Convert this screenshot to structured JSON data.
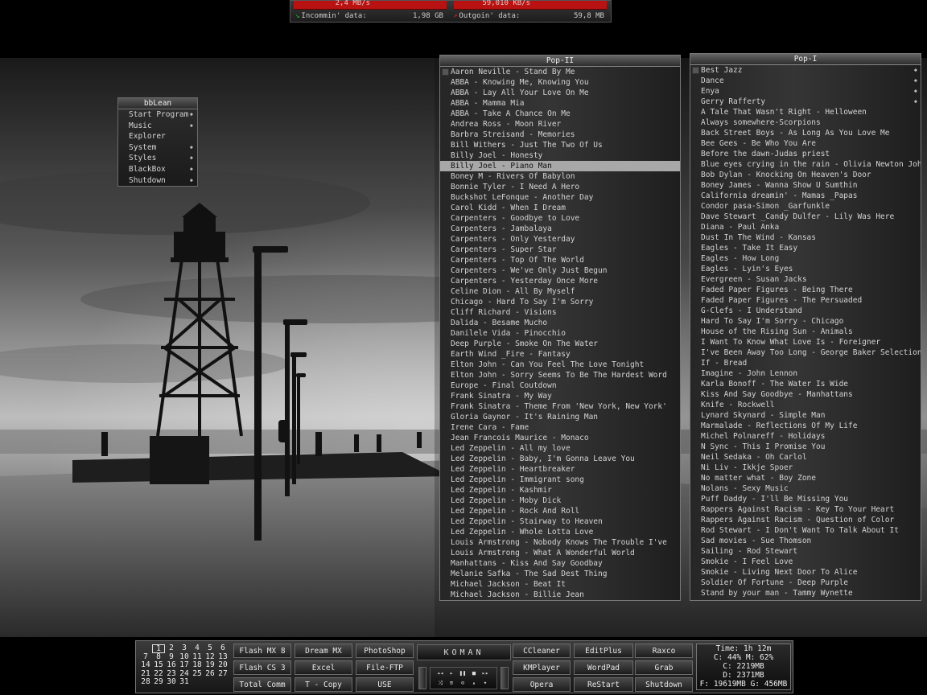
{
  "netmeter": {
    "in_rate": "2,4 MB/s",
    "out_rate": "59,010 KB/s",
    "in_label": "Incommin' data:",
    "in_value": "1,98 GB",
    "out_label": "Outgoin' data:",
    "out_value": "59,8 MB",
    "colors": {
      "bar": "#b81212",
      "in_arrow": "#2fbf2f",
      "out_arrow": "#d43030"
    }
  },
  "bbmenu": {
    "title": "bbLean",
    "items": [
      {
        "label": "Start Program",
        "submenu": true
      },
      {
        "label": "Music",
        "submenu": true
      },
      {
        "label": "Explorer",
        "submenu": false
      },
      {
        "label": "System",
        "submenu": true
      },
      {
        "label": "Styles",
        "submenu": true
      },
      {
        "label": "BlackBox",
        "submenu": true
      },
      {
        "label": "Shutdown",
        "submenu": true
      }
    ]
  },
  "pop2": {
    "title": "Pop-II",
    "selected_index": 9,
    "items": [
      "Aaron Neville - Stand By Me",
      "ABBA - Knowing Me, Knowing You",
      "ABBA - Lay All Your Love On Me",
      "ABBA - Mamma Mia",
      "ABBA - Take A Chance On Me",
      "Andrea Ross - Moon River",
      "Barbra Streisand - Memories",
      "Bill Withers - Just The Two Of Us",
      "Billy Joel - Honesty",
      "Billy Joel - Piano Man",
      "Boney M - Rivers Of Babylon",
      "Bonnie Tyler - I Need A Hero",
      "Buckshot LeFonque - Another Day",
      "Carol Kidd - When I Dream",
      "Carpenters - Goodbye to Love",
      "Carpenters - Jambalaya",
      "Carpenters - Only Yesterday",
      "Carpenters - Super Star",
      "Carpenters - Top Of The World",
      "Carpenters - We've Only Just Begun",
      "Carpenters - Yesterday Once More",
      "Celine Dion - All By Myself",
      "Chicago - Hard To Say I'm Sorry",
      "Cliff Richard - Visions",
      "Dalida - Besame Mucho",
      "Danilele Vida - Pinocchio",
      "Deep Purple - Smoke On The Water",
      "Earth Wind _Fire - Fantasy",
      "Elton John - Can You Feel The Love Tonight",
      "Elton John - Sorry Seems To Be The Hardest Word",
      "Europe - Final Coutdown",
      "Frank Sinatra - My Way",
      "Frank Sinatra - Theme From 'New York, New York'",
      "Gloria Gaynor - It's Raining Man",
      "Irene Cara - Fame",
      "Jean Francois Maurice - Monaco",
      "Led Zeppelin - All my love",
      "Led Zeppelin - Baby, I'm Gonna Leave You",
      "Led Zeppelin - Heartbreaker",
      "Led Zeppelin - Immigrant song",
      "Led Zeppelin - Kashmir",
      "Led Zeppelin - Moby Dick",
      "Led Zeppelin - Rock And Roll",
      "Led Zeppelin - Stairway to Heaven",
      "Led Zeppelin - Whole Lotta Love",
      "Louis Armstrong - Nobody Knows The Trouble I've",
      "Louis Armstrong - What A Wonderful World",
      "Manhattans - Kiss And Say Goodbay",
      "Melanie Safka - The Sad Dest Thing",
      "Michael Jackson - Beat It",
      "Michael Jackson - Billie Jean"
    ]
  },
  "pop1": {
    "title": "Pop-I",
    "folders": [
      "Best Jazz",
      "Dance",
      "Enya",
      "Gerry Rafferty"
    ],
    "items": [
      "A Tale That Wasn't Right - Helloween",
      "Always somewhere-Scorpions",
      "Back Street Boys - As Long As You Love Me",
      "Bee Gees - Be Who You Are",
      "Before the dawn-Judas priest",
      "Blue eyes crying in the rain - Olivia Newton John",
      "Bob Dylan - Knocking On Heaven's Door",
      "Boney James - Wanna Show U Sumthin",
      "California dreamin' - Mamas _Papas",
      "Condor pasa-Simon _Garfunkle",
      "Dave Stewart _Candy Dulfer - Lily Was Here",
      "Diana - Paul Anka",
      "Dust In The Wind - Kansas",
      "Eagles - Take It Easy",
      "Eagles - How Long",
      "Eagles - Lyin's Eyes",
      "Evergreen - Susan Jacks",
      "Faded Paper Figures - Being There",
      "Faded Paper Figures - The Persuaded",
      "G-Clefs - I Understand",
      "Hard To Say I'm Sorry - Chicago",
      "House of the Rising Sun - Animals",
      "I Want To Know What Love Is - Foreigner",
      "I've Been Away Too Long - George Baker Selection",
      "If - Bread",
      "Imagine - John Lennon",
      "Karla Bonoff - The Water Is Wide",
      "Kiss And Say Goodbye - Manhattans",
      "Knife - Rockwell",
      "Lynard Skynard - Simple Man",
      "Marmalade - Reflections Of My Life",
      "Michel Polnareff - Holidays",
      "N Sync - This I Promise You",
      "Neil Sedaka - Oh Carlol",
      "Ni Liv - Ikkje Spoer",
      "No matter what - Boy Zone",
      "Nolans - Sexy Music",
      "Puff Daddy - I'll Be Missing You",
      "Rappers Against Racism - Key To Your Heart",
      "Rappers Against Racism - Question of Color",
      "Rod Stewart - I Don't Want To Talk About It",
      "Sad movies - Sue Thomson",
      "Sailing - Rod Stewart",
      "Smokie - I Feel Love",
      "Smokie - Living Next Door To Alice",
      "Soldier Of Fortune - Deep Purple",
      "Stand by your man - Tammy Wynette"
    ]
  },
  "calendar": {
    "today": "1",
    "rows": [
      [
        "",
        "1",
        "2",
        "3",
        "4",
        "5",
        "6"
      ],
      [
        "7",
        "8",
        "9",
        "10",
        "11",
        "12",
        "13"
      ],
      [
        "14",
        "15",
        "16",
        "17",
        "18",
        "19",
        "20"
      ],
      [
        "21",
        "22",
        "23",
        "24",
        "25",
        "26",
        "27"
      ],
      [
        "28",
        "29",
        "30",
        "31",
        "",
        "",
        ""
      ]
    ]
  },
  "launch_col1": [
    "Flash MX 8",
    "Flash CS 3",
    "Total Comm"
  ],
  "launch_col2": [
    "Dream MX",
    "Excel",
    "T - Copy"
  ],
  "launch_col3": [
    "PhotoShop",
    "File-FTP",
    "USE"
  ],
  "koman": {
    "title": "KOMAN",
    "controls": [
      "◂◂",
      "▸",
      "❚❚",
      "■",
      "▸▸",
      "⤨",
      "≡",
      "⊙",
      "▴",
      "▾"
    ]
  },
  "launch_col4": [
    "CCleaner",
    "KMPlayer",
    "Opera"
  ],
  "launch_col5": [
    "EditPlus",
    "WordPad",
    "ReStart"
  ],
  "launch_col6": [
    "Raxco",
    "Grab",
    "Shutdown"
  ],
  "sysinfo": {
    "time": "Time: 1h 12m",
    "cpu_mem": "C: 44%  M: 62%",
    "drive_c": "C: 2219MB",
    "drive_d": "D: 2371MB",
    "drive_fg": "F: 19619MB G: 456MB"
  }
}
